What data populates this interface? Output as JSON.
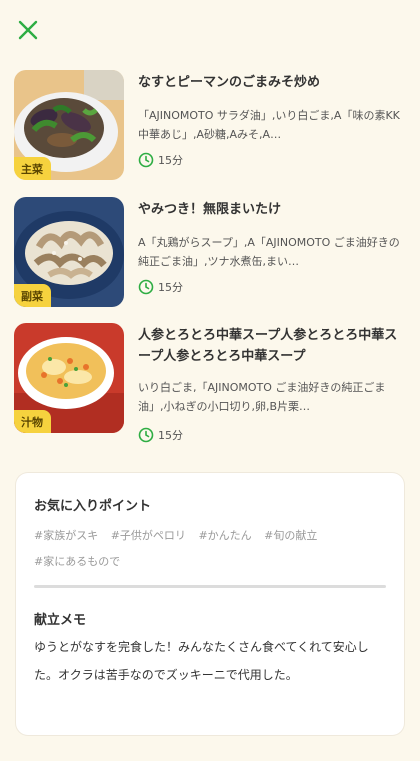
{
  "close_icon": "close-icon",
  "recipes": [
    {
      "title": "なすとピーマンのごまみそ炒め",
      "tag": "主菜",
      "description": "「AJINOMOTO サラダ油」,いり白ごま,A「味の素KK中華あじ」,A砂糖,Aみそ,A…",
      "time": "15分"
    },
    {
      "title": "やみつき！無限まいたけ",
      "tag": "副菜",
      "description": "A「丸鶏がらスープ」,A「AJINOMOTO ごま油好きの純正ごま油」,ツナ水煮缶,まい…",
      "time": "15分"
    },
    {
      "title": "人参とろとろ中華スープ人参とろとろ中華スープ人参とろとろ中華スープ",
      "tag": "汁物",
      "description": "いり白ごま,「AJINOMOTO ごま油好きの純正ごま油」,小ねぎの小口切り,卵,B片栗…",
      "time": "15分"
    }
  ],
  "favorites": {
    "heading": "お気に入りポイント",
    "tags": [
      "#家族がスキ",
      "#子供がペロリ",
      "#かんたん",
      "#旬の献立",
      "#家にあるもので"
    ]
  },
  "memo": {
    "heading": "献立メモ",
    "text": "ゆうとがなすを完食した！みんなたくさん食べてくれて安心した。オクラは苦手なのでズッキーニで代用した。"
  },
  "colors": {
    "accent": "#2ead43",
    "tag_bg": "#f6d23e",
    "background": "#fcf8ec"
  }
}
